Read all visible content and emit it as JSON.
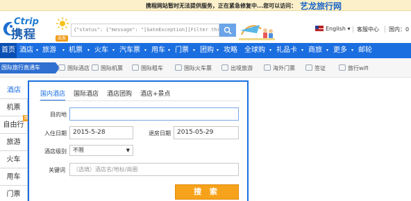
{
  "notice": {
    "text": "携程网站暂时无法提供服务，正在紧急修复中...您可以访问：",
    "link": "艺龙旅行网"
  },
  "header": {
    "logo_en": "Ctrip",
    "logo_cn": "携程",
    "badge": "出发",
    "search_value": "{\"status\": {\"message\": \"[GateException][Filter threw Exception",
    "language": "English",
    "service": "客服中心",
    "hotline": "国内：0"
  },
  "mainnav": [
    "首页",
    "酒店",
    "旅游",
    "机票",
    "火车",
    "汽车票",
    "用车",
    "门票",
    "团购",
    "攻略",
    "全球购",
    "礼品卡",
    "商旅",
    "更多",
    "邮轮"
  ],
  "subnav": {
    "first": "国际旅行直通车",
    "items": [
      "国际酒店",
      "国际机票",
      "国际租车",
      "国际火车票",
      "出境旅游",
      "海外门票",
      "签证",
      "旅行wifi"
    ]
  },
  "sidetabs": [
    "酒店",
    "机票",
    "自由行",
    "旅游",
    "火车",
    "用车",
    "门票"
  ],
  "side_hot": "惠",
  "panel": {
    "tabs": [
      "国内酒店",
      "国际酒店",
      "酒店团购",
      "酒店+景点"
    ],
    "destination_label": "目的地",
    "destination_value": "",
    "checkin_label": "入住日期",
    "checkin_value": "2015-5-28",
    "checkout_label": "退房日期",
    "checkout_value": "2015-05-29",
    "level_label": "酒店级别",
    "level_value": "不限",
    "keyword_label": "关键词",
    "keyword_placeholder": "（选填）酒店名/地标/商圈",
    "submit_label": "搜 索"
  },
  "colors": {
    "nav_blue": "#1b6ee0",
    "submit_orange": "#f7a21b",
    "notice_bg": "#fbf0c9"
  }
}
